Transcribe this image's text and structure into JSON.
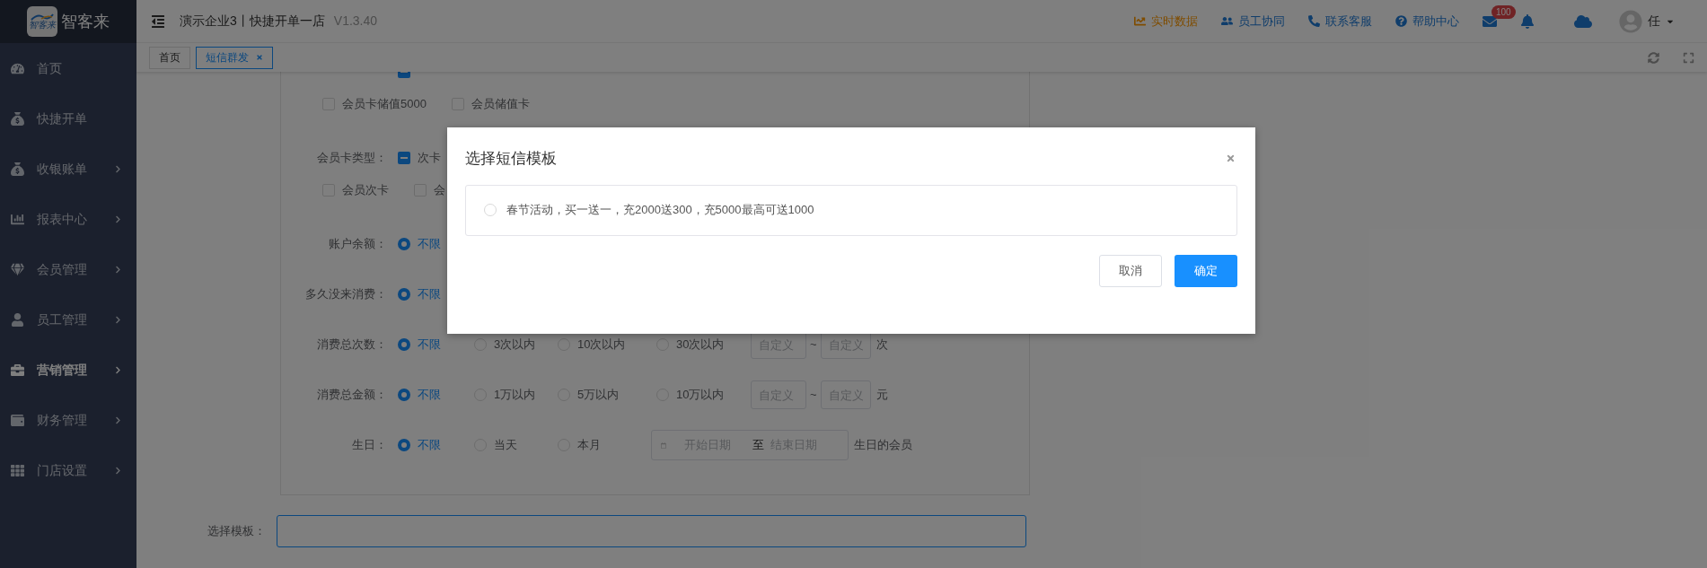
{
  "logo": {
    "mark": "智客来",
    "name": "智客来"
  },
  "sidebar": {
    "items": [
      {
        "label": "首页",
        "kind": "dashboard",
        "has_submenu": false,
        "selected": false
      },
      {
        "label": "快捷开单",
        "kind": "moneybag",
        "has_submenu": false,
        "selected": false
      },
      {
        "label": "收银账单",
        "kind": "moneybag",
        "has_submenu": true,
        "selected": false
      },
      {
        "label": "报表中心",
        "kind": "chart",
        "has_submenu": true,
        "selected": false
      },
      {
        "label": "会员管理",
        "kind": "gem",
        "has_submenu": true,
        "selected": false
      },
      {
        "label": "员工管理",
        "kind": "user",
        "has_submenu": true,
        "selected": false
      },
      {
        "label": "营销管理",
        "kind": "briefcase",
        "has_submenu": true,
        "selected": true
      },
      {
        "label": "财务管理",
        "kind": "wallet",
        "has_submenu": true,
        "selected": false
      },
      {
        "label": "门店设置",
        "kind": "grid",
        "has_submenu": true,
        "selected": false
      }
    ]
  },
  "header": {
    "title": "演示企业3丨快捷开单一店",
    "version": "V1.3.40",
    "links": [
      {
        "label": "实时数据",
        "kind": "realtime"
      },
      {
        "label": "员工协同",
        "kind": "team"
      },
      {
        "label": "联系客服",
        "kind": "phone"
      },
      {
        "label": "帮助中心",
        "kind": "help"
      }
    ],
    "mail_badge": "100",
    "user": "任"
  },
  "tabs": [
    {
      "label": "首页",
      "selected": false,
      "closable": false
    },
    {
      "label": "短信群发",
      "selected": true,
      "closable": true
    }
  ],
  "form": {
    "groups": [
      {
        "header": {
          "indeterminate": true
        },
        "options": [
          {
            "label": "会员卡储值5000",
            "checked": false
          },
          {
            "label": "会员储值卡",
            "checked": false
          }
        ]
      },
      {
        "label": "会员卡类型：",
        "header": {
          "label": "次卡",
          "indeterminate": true
        },
        "options": [
          {
            "label": "会员次卡",
            "checked": false
          },
          {
            "label": "会",
            "checked": false
          }
        ]
      }
    ],
    "radio_rows": [
      {
        "label": "账户余额：",
        "options": [
          {
            "label": "不限",
            "selected": true
          }
        ]
      },
      {
        "label": "多久没来消费：",
        "options": [
          {
            "label": "不限",
            "selected": true
          }
        ]
      },
      {
        "label": "消费总次数：",
        "options": [
          {
            "label": "不限",
            "selected": true
          },
          {
            "label": "3次以内",
            "selected": false
          },
          {
            "label": "10次以内",
            "selected": false
          },
          {
            "label": "30次以内",
            "selected": false
          }
        ],
        "range": {
          "kind": "number",
          "from": {
            "placeholder": "自定义"
          },
          "separator": "~",
          "to": {
            "placeholder": "自定义"
          },
          "unit": "次"
        }
      },
      {
        "label": "消费总金额：",
        "options": [
          {
            "label": "不限",
            "selected": true
          },
          {
            "label": "1万以内",
            "selected": false
          },
          {
            "label": "5万以内",
            "selected": false
          },
          {
            "label": "10万以内",
            "selected": false
          }
        ],
        "range": {
          "kind": "number",
          "from": {
            "placeholder": "自定义"
          },
          "separator": "~",
          "to": {
            "placeholder": "自定义"
          },
          "unit": "元"
        }
      },
      {
        "label": "生日：",
        "options": [
          {
            "label": "不限",
            "selected": true
          },
          {
            "label": "当天",
            "selected": false
          },
          {
            "label": "本月",
            "selected": false
          }
        ],
        "range": {
          "kind": "date",
          "from": {
            "placeholder": "开始日期"
          },
          "separator": "至",
          "to": {
            "placeholder": "结束日期"
          },
          "unit": "生日的会员"
        }
      }
    ],
    "template": {
      "label": "选择模板："
    }
  },
  "dialog": {
    "title": "选择短信模板",
    "options": [
      {
        "label": "春节活动，买一送一，充2000送300，充5000最高可送1000",
        "selected": false
      }
    ],
    "buttons": [
      {
        "label": "取消",
        "kind": "default"
      },
      {
        "label": "确定",
        "kind": "primary"
      }
    ]
  }
}
